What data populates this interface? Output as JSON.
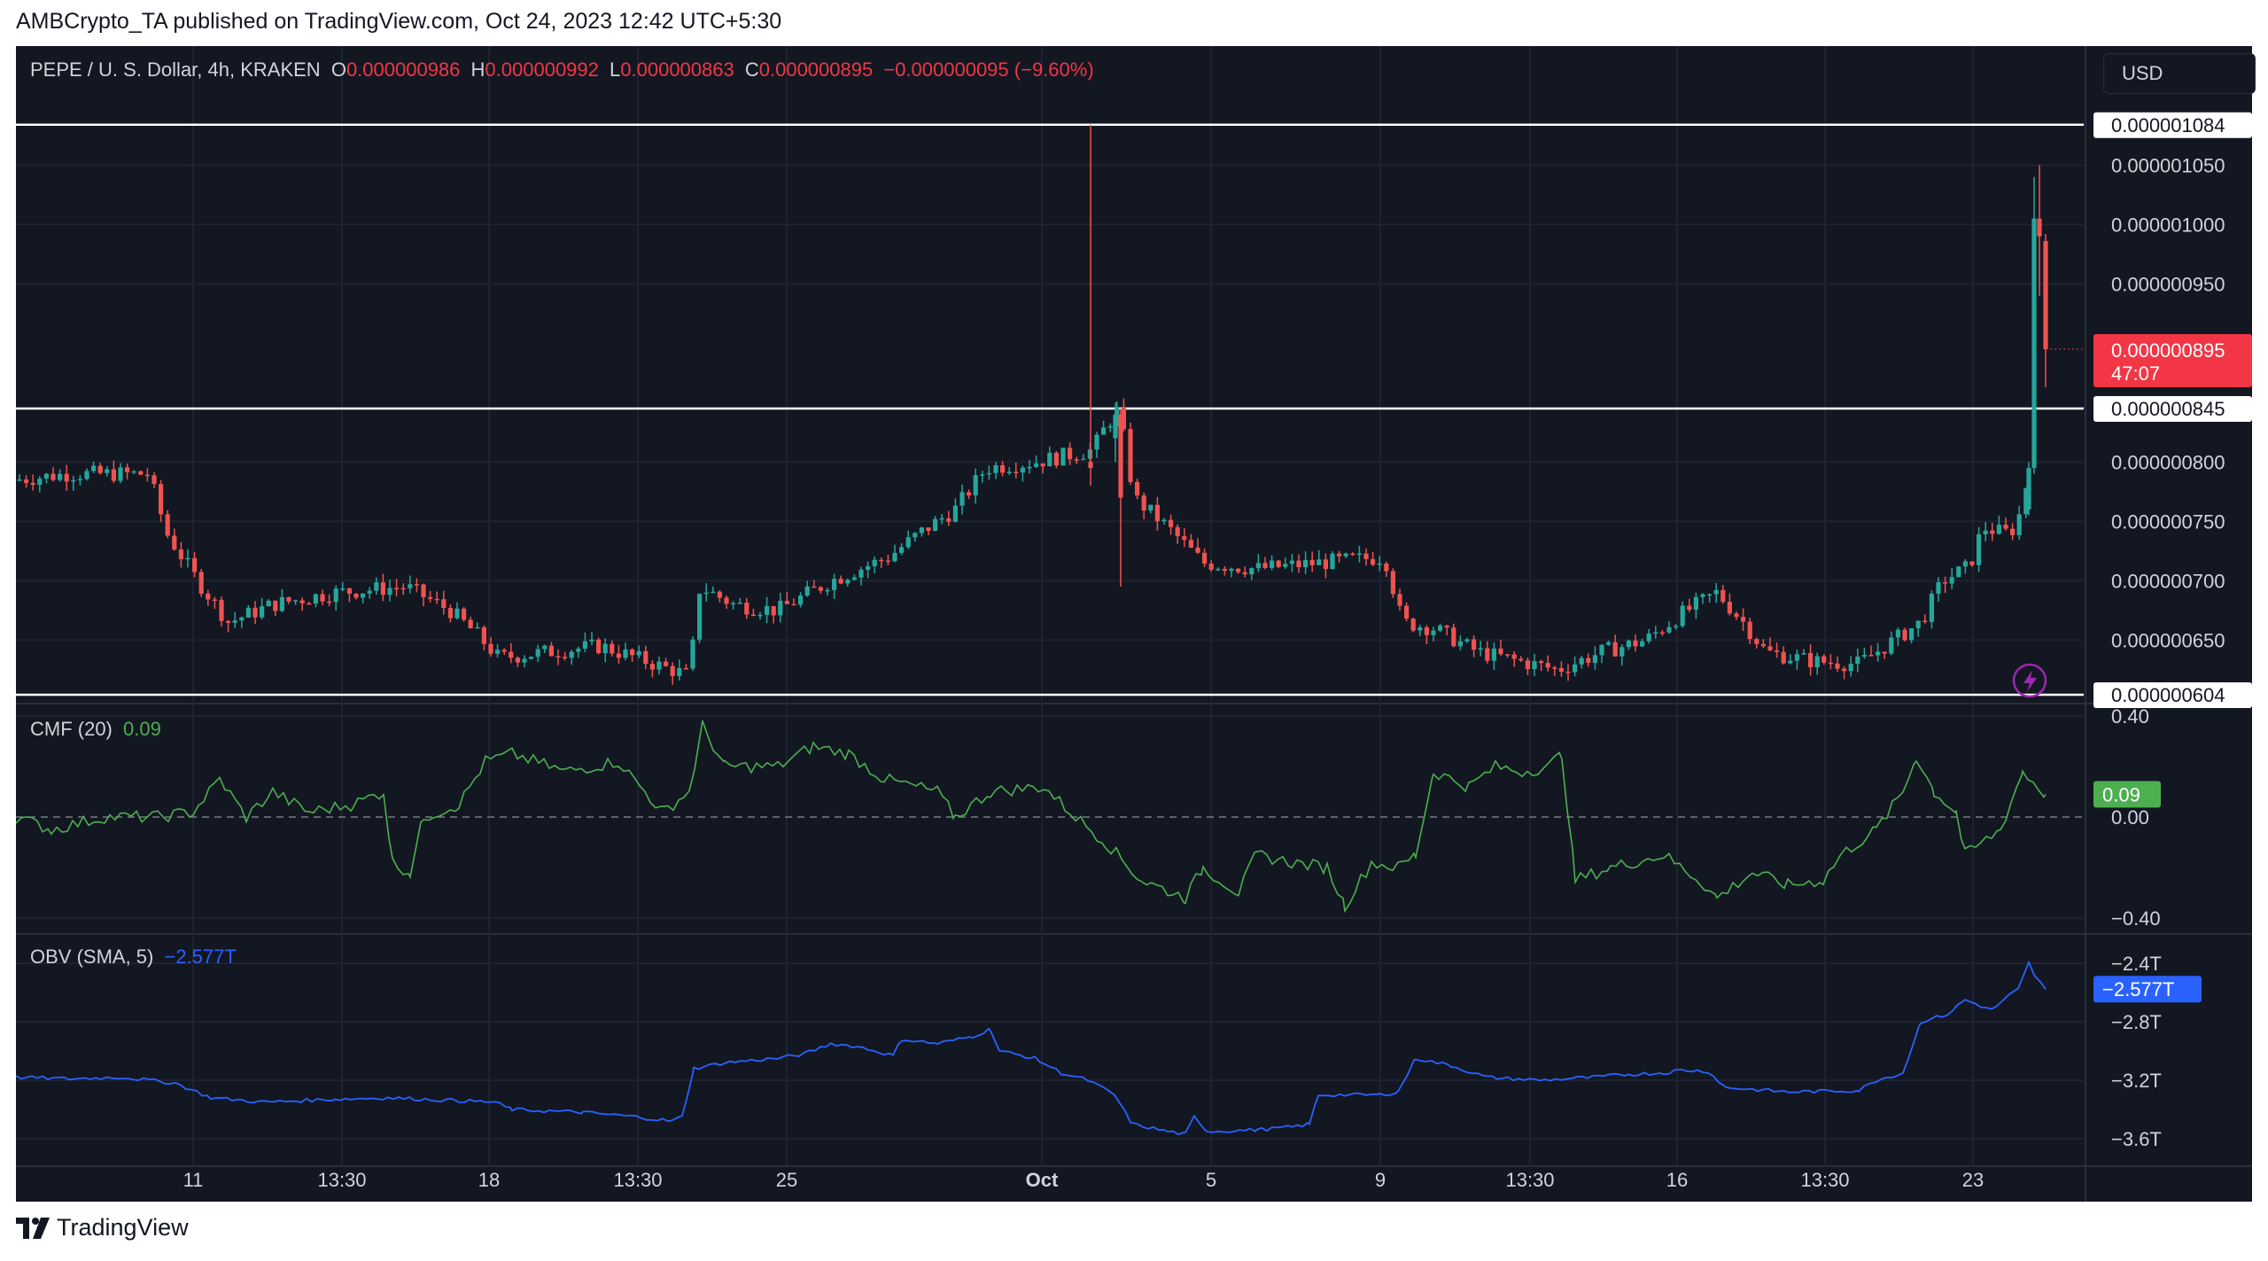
{
  "header": {
    "publisher": "AMBCrypto_TA published on TradingView.com, Oct 24, 2023 12:42 UTC+5:30"
  },
  "legend": {
    "symbol": "PEPE / U. S. Dollar, 4h, KRAKEN",
    "o_label": "O",
    "o_value": "0.000000986",
    "h_label": "H",
    "h_value": "0.000000992",
    "l_label": "L",
    "l_value": "0.000000863",
    "c_label": "C",
    "c_value": "0.000000895",
    "change": "−0.000000095 (−9.60%)"
  },
  "currency": "USD",
  "price_axis": {
    "ticks": [
      "0.000001050",
      "0.000001000",
      "0.000000950",
      "0.000000800",
      "0.000000750",
      "0.000000700",
      "0.000000650"
    ],
    "tick_values": [
      1.05,
      1.0,
      0.95,
      0.8,
      0.75,
      0.7,
      0.65
    ],
    "current_label": "0.000000895",
    "countdown": "47:07",
    "level_labels": [
      "0.000001084",
      "0.000000845",
      "0.000000604"
    ]
  },
  "cmf": {
    "label": "CMF (20)",
    "value": "0.09",
    "ticks": [
      "0.40",
      "0.00",
      "−0.40"
    ],
    "tick_values": [
      0.4,
      0.0,
      -0.4
    ],
    "current_label": "0.09"
  },
  "obv": {
    "label": "OBV (SMA, 5)",
    "value": "−2.577T",
    "ticks": [
      "−2.4T",
      "−2.8T",
      "−3.2T",
      "−3.6T"
    ],
    "tick_values": [
      -2.4,
      -2.8,
      -3.2,
      -3.6
    ],
    "current_label": "−2.577T"
  },
  "time_axis": {
    "labels": [
      "11",
      "13:30",
      "18",
      "13:30",
      "25",
      "Oct",
      "5",
      "9",
      "13:30",
      "16",
      "13:30",
      "23"
    ],
    "bold": [
      false,
      false,
      false,
      false,
      false,
      true,
      false,
      false,
      false,
      false,
      false,
      false
    ]
  },
  "footer": {
    "brand": "TradingView"
  },
  "colors": {
    "up": "#26a69a",
    "down": "#ef5350",
    "bg": "#131722",
    "grid": "#1f2330",
    "text": "#d1d4dc",
    "cmf": "#4caf50",
    "obv": "#2962ff"
  },
  "chart_data": {
    "type": "candlestick",
    "title": "PEPE / U. S. Dollar, 4h, KRAKEN",
    "price_unit_note": "prices in units of 1e-6 USD",
    "horizontal_levels": [
      1.084,
      0.845,
      0.604
    ],
    "price_range": [
      0.598,
      1.098
    ],
    "key_points": {
      "x": [
        "Sep 8",
        "Sep 11",
        "Sep 12",
        "Sep 18",
        "Sep 20",
        "Sep 21",
        "Sep 25",
        "Sep 28",
        "Oct 1",
        "Oct 2",
        "Oct 3",
        "Oct 5",
        "Oct 9",
        "Oct 12",
        "Oct 16",
        "Oct 17",
        "Oct 19",
        "Oct 22",
        "Oct 23",
        "Oct 23 20:00",
        "Oct 24"
      ],
      "close": [
        0.79,
        0.79,
        0.68,
        0.64,
        0.62,
        0.7,
        0.69,
        0.76,
        0.8,
        0.84,
        0.74,
        0.71,
        0.7,
        0.63,
        0.66,
        0.7,
        0.63,
        0.7,
        0.76,
        1.0,
        0.895
      ]
    },
    "cmf_series": {
      "name": "CMF (20)",
      "x": [
        "Sep 8",
        "Sep 12",
        "Sep 14",
        "Sep 18",
        "Sep 21",
        "Sep 25",
        "Sep 28",
        "Oct 1",
        "Oct 3",
        "Oct 5",
        "Oct 9",
        "Oct 12",
        "Oct 14",
        "Oct 17",
        "Oct 19",
        "Oct 21",
        "Oct 22",
        "Oct 23",
        "Oct 24"
      ],
      "y": [
        0.0,
        0.05,
        -0.15,
        0.22,
        0.05,
        0.2,
        0.05,
        0.1,
        -0.2,
        -0.18,
        0.05,
        0.25,
        -0.25,
        -0.25,
        -0.2,
        0.0,
        0.25,
        -0.05,
        0.09
      ],
      "ylim": [
        -0.4,
        0.4
      ]
    },
    "obv_series": {
      "name": "OBV (SMA, 5)",
      "x": [
        "Sep 8",
        "Sep 11",
        "Sep 18",
        "Sep 21",
        "Sep 22",
        "Sep 25",
        "Sep 28",
        "Oct 1",
        "Oct 3",
        "Oct 5",
        "Oct 9",
        "Oct 12",
        "Oct 16",
        "Oct 19",
        "Oct 21",
        "Oct 22",
        "Oct 23",
        "Oct 24"
      ],
      "y": [
        -3.2,
        -3.25,
        -3.4,
        -3.45,
        -3.1,
        -3.0,
        -2.95,
        -3.1,
        -3.5,
        -3.55,
        -3.3,
        -3.2,
        -3.2,
        -3.25,
        -3.2,
        -2.9,
        -2.8,
        -2.577
      ],
      "ylim": [
        -3.7,
        -2.35
      ]
    }
  }
}
